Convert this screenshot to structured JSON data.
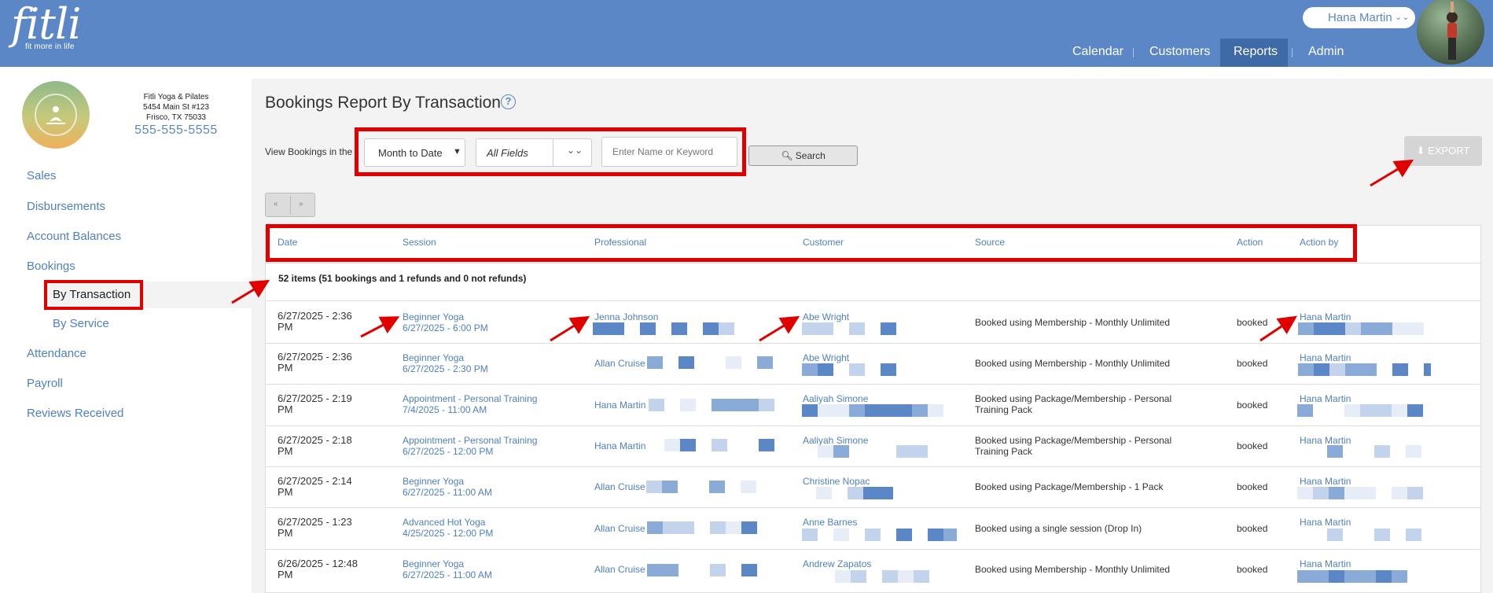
{
  "header": {
    "logo_word": "fitli",
    "logo_tagline": "fit more in life",
    "user_name": "Hana Martin",
    "nav": [
      {
        "label": "Calendar"
      },
      {
        "label": "Customers"
      },
      {
        "label": "Reports"
      },
      {
        "label": "Admin"
      }
    ],
    "active_nav": "Reports"
  },
  "studio": {
    "name": "Fitli Yoga & Pilates",
    "address1": "5454 Main St #123",
    "address2": "Frisco, TX 75033",
    "phone": "555-555-5555"
  },
  "sidebar": {
    "items": [
      {
        "label": "Sales"
      },
      {
        "label": "Disbursements"
      },
      {
        "label": "Account Balances"
      },
      {
        "label": "Bookings"
      },
      {
        "label": "Attendance"
      },
      {
        "label": "Payroll"
      },
      {
        "label": "Reviews Received"
      }
    ],
    "subitems": [
      {
        "label": "By Transaction",
        "active": true
      },
      {
        "label": "By Service",
        "active": false
      }
    ]
  },
  "report": {
    "title": "Bookings Report By Transaction",
    "help_glyph": "?",
    "filter_label": "View Bookings in the",
    "period_value": "Month to Date",
    "fields_value": "All Fields",
    "keyword_placeholder": "Enter Name or Keyword",
    "search_label": "Search",
    "export_label": "EXPORT",
    "pager_prev": "«",
    "pager_next": "»",
    "summary": "52 items (51 bookings and 1 refunds and 0 not refunds)"
  },
  "table": {
    "columns": [
      "Date",
      "Session",
      "Professional",
      "Customer",
      "Source",
      "Action",
      "Action by"
    ],
    "rows": [
      {
        "date1": "6/27/2025 - 2:36",
        "date2": "PM",
        "session": "Beginner Yoga",
        "session_time": "6/27/2025 - 6:00 PM",
        "professional": "Jenna Johnson",
        "customer": "Abe Wright",
        "source": "Booked using Membership - Monthly Unlimited",
        "action": "booked",
        "action_by": "Hana Martin"
      },
      {
        "date1": "6/27/2025 - 2:36",
        "date2": "PM",
        "session": "Beginner Yoga",
        "session_time": "6/27/2025 - 2:30 PM",
        "professional": "Allan Cruise",
        "customer": "Abe Wright",
        "source": "Booked using Membership - Monthly Unlimited",
        "action": "booked",
        "action_by": "Hana Martin"
      },
      {
        "date1": "6/27/2025 - 2:19",
        "date2": "PM",
        "session": "Appointment - Personal Training",
        "session_time": "7/4/2025 - 11:00 AM",
        "professional": "Hana Martin",
        "customer": "Aaliyah Simone",
        "source": "Booked using Package/Membership - Personal Training Pack",
        "action": "booked",
        "action_by": "Hana Martin"
      },
      {
        "date1": "6/27/2025 - 2:18",
        "date2": "PM",
        "session": "Appointment - Personal Training",
        "session_time": "6/27/2025 - 12:00 PM",
        "professional": "Hana Martin",
        "customer": "Aaliyah Simone",
        "source": "Booked using Package/Membership - Personal Training Pack",
        "action": "booked",
        "action_by": "Hana Martin"
      },
      {
        "date1": "6/27/2025 - 2:14",
        "date2": "PM",
        "session": "Beginner Yoga",
        "session_time": "6/27/2025 - 11:00 AM",
        "professional": "Allan Cruise",
        "customer": "Christine Nopac",
        "source": "Booked using Package/Membership - 1 Pack",
        "action": "booked",
        "action_by": "Hana Martin"
      },
      {
        "date1": "6/27/2025 - 1:23",
        "date2": "PM",
        "session": "Advanced Hot Yoga",
        "session_time": "4/25/2025 - 12:00 PM",
        "professional": "Allan Cruise",
        "customer": "Anne Barnes",
        "source": "Booked using a single session (Drop In)",
        "action": "booked",
        "action_by": "Hana Martin"
      },
      {
        "date1": "6/26/2025 - 12:48",
        "date2": "PM",
        "session": "Beginner Yoga",
        "session_time": "6/27/2025 - 11:00 AM",
        "professional": "Allan Cruise",
        "customer": "Andrew Zapatos",
        "source": "Booked using Membership - Monthly Unlimited",
        "action": "booked",
        "action_by": "Hana Martin"
      }
    ]
  },
  "colors": {
    "brand_blue": "#5b87c7",
    "active_nav": "#3f6aa8",
    "annotation_red": "#e00000"
  }
}
